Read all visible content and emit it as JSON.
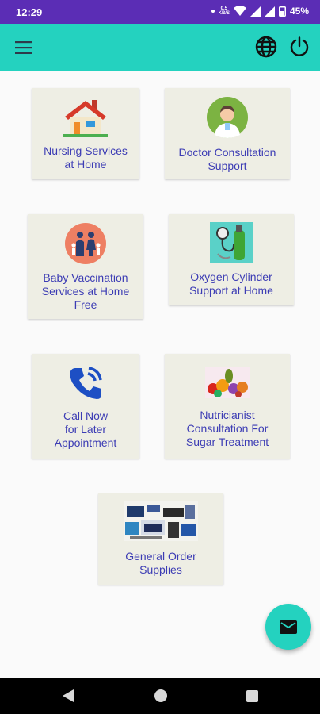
{
  "status_bar": {
    "time": "12:29",
    "network_speed_value": "0.5",
    "network_speed_unit": "KB/S",
    "battery_percent": "45%"
  },
  "app_bar": {
    "icons": [
      "menu-icon",
      "globe-icon",
      "power-icon"
    ]
  },
  "services": [
    {
      "label": "Nursing Services\nat Home",
      "icon": "house-icon"
    },
    {
      "label": "Doctor Consultation\nSupport",
      "icon": "doctor-icon"
    },
    {
      "label": "Baby Vaccination\nServices at Home\nFree",
      "icon": "family-icon"
    },
    {
      "label": "Oxygen Cylinder\nSupport at Home",
      "icon": "oxygen-cylinder-icon"
    },
    {
      "label": "Call Now\nfor Later\nAppointment",
      "icon": "phone-call-icon"
    },
    {
      "label": "Nutricianist\nConsultation For\nSugar Treatment",
      "icon": "fruits-icon"
    },
    {
      "label": "General Order\nSupplies",
      "icon": "supplies-icon"
    }
  ],
  "fab": {
    "icon": "mail-icon"
  },
  "colors": {
    "status_bar": "#5b2db5",
    "app_bar": "#24d2bf",
    "card_background": "#eeeee4",
    "label_text": "#3c3cb4"
  }
}
